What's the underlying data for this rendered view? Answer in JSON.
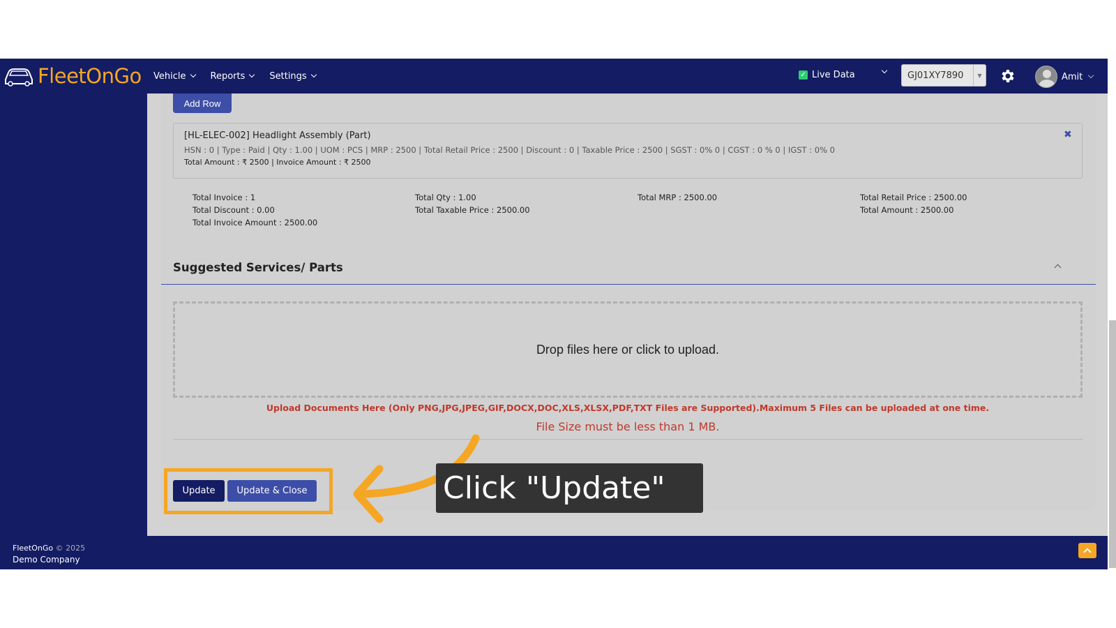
{
  "brand": {
    "name": "FleetOnGo"
  },
  "nav": {
    "items": [
      {
        "label": "Vehicle"
      },
      {
        "label": "Reports"
      },
      {
        "label": "Settings"
      }
    ],
    "live_data_label": "Live Data",
    "vehicle_select_value": "GJ01XY7890",
    "user_name": "Amit"
  },
  "invoice": {
    "add_row_label": "Add Row",
    "part": {
      "title": "[HL-ELEC-002] Headlight Assembly (Part)",
      "details": "HSN : 0 | Type : Paid | Qty : 1.00 | UOM : PCS | MRP : 2500 | Total Retail Price : 2500 | Discount : 0 | Taxable Price : 2500 | SGST : 0% 0 | CGST : 0 % 0 | IGST : 0% 0",
      "amounts": "Total Amount : ₹ 2500 | Invoice Amount : ₹ 2500",
      "remove_icon": "close-icon"
    },
    "totals": {
      "total_invoice": "Total Invoice : 1",
      "total_discount": "Total Discount : 0.00",
      "total_invoice_amount": "Total Invoice Amount : 2500.00",
      "total_qty": "Total Qty : 1.00",
      "total_taxable_price": "Total Taxable Price : 2500.00",
      "total_mrp": "Total MRP : 2500.00",
      "total_retail_price": "Total Retail Price : 2500.00",
      "total_amount": "Total Amount : 2500.00"
    }
  },
  "suggested": {
    "title": "Suggested Services/ Parts",
    "dropzone_text": "Drop files here or click to upload.",
    "upload_note": "Upload Documents Here (Only PNG,JPG,JPEG,GIF,DOCX,DOC,XLS,XLSX,PDF,TXT Files are Supported).Maximum 5 Files can be uploaded at one time.",
    "size_note": "File Size must be less than 1 MB."
  },
  "actions": {
    "update_label": "Update",
    "update_close_label": "Update & Close"
  },
  "callout": {
    "text": "Click \"Update\""
  },
  "footer": {
    "brand": "FleetOnGo",
    "year": "© 2025",
    "company": "Demo Company"
  },
  "colors": {
    "navy": "#141c63",
    "accent_blue": "#3d4ea8",
    "orange": "#f5a623",
    "error_red": "#c0392b"
  }
}
